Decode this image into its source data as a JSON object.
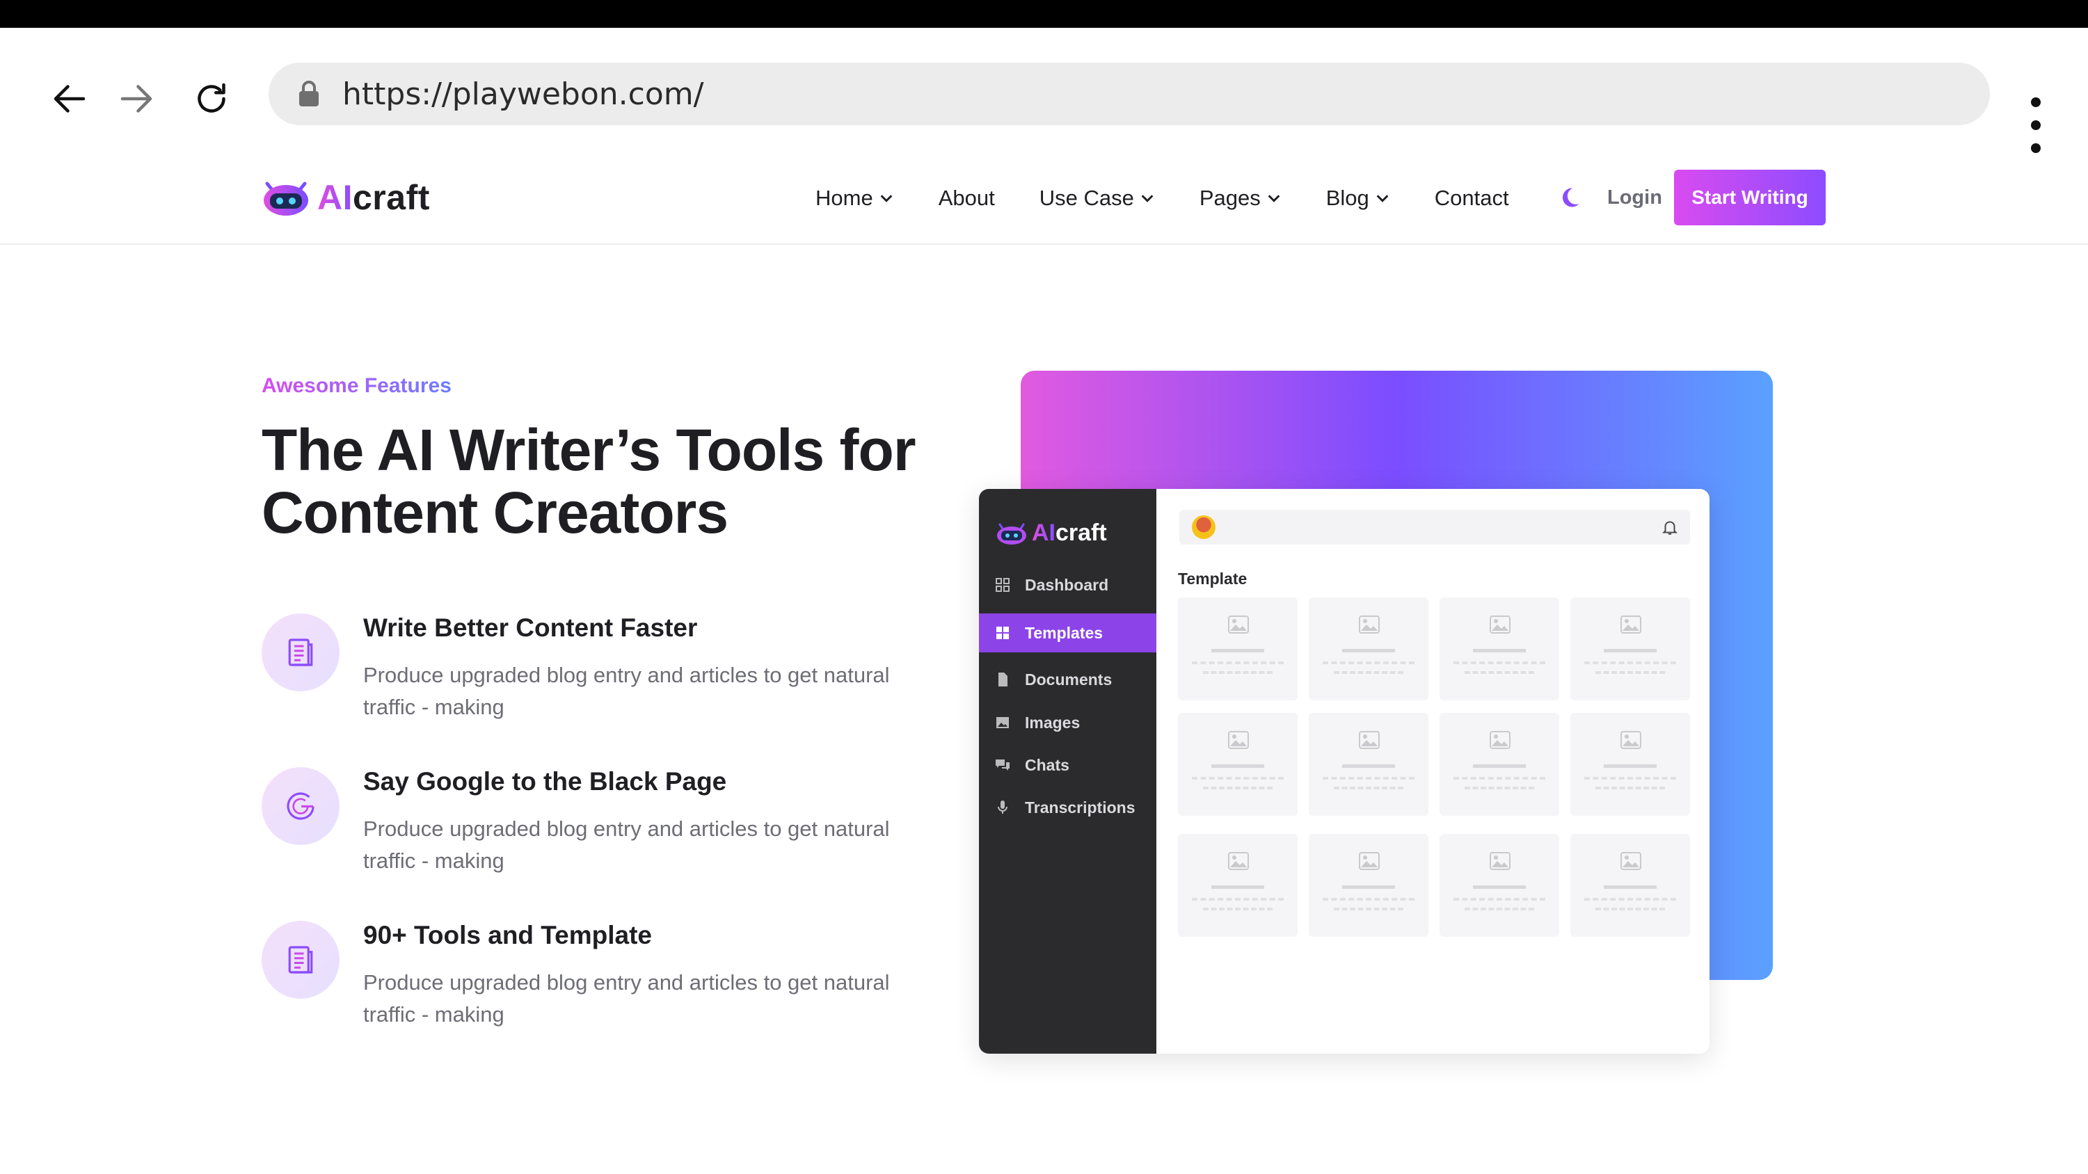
{
  "browser": {
    "url": "https://playwebon.com/",
    "back_icon": "arrow-left-icon",
    "forward_icon": "arrow-right-icon",
    "reload_icon": "reload-icon",
    "menu_icon": "kebab-menu-icon"
  },
  "header": {
    "brand_ai": "AI",
    "brand_rest": "craft",
    "menu": [
      {
        "label": "Home",
        "dropdown": true
      },
      {
        "label": "About",
        "dropdown": false
      },
      {
        "label": "Use Case",
        "dropdown": true
      },
      {
        "label": "Pages",
        "dropdown": true
      },
      {
        "label": "Blog",
        "dropdown": true
      },
      {
        "label": "Contact",
        "dropdown": false
      }
    ],
    "login": "Login",
    "cta": "Start Writing"
  },
  "hero": {
    "eyebrow": "Awesome Features",
    "headline_line1": "The AI Writer’s Tools for",
    "headline_line2": "Content Creators"
  },
  "features": [
    {
      "icon": "document-icon",
      "title": "Write Better Content Faster",
      "desc_line1": "Produce upgraded blog entry and articles to get natural",
      "desc_line2": "traffic - making"
    },
    {
      "icon": "google-icon",
      "title": "Say Google to the Black Page",
      "desc_line1": "Produce upgraded blog entry and articles to get natural",
      "desc_line2": "traffic - making"
    },
    {
      "icon": "document-icon",
      "title": "90+ Tools and Template",
      "desc_line1": "Produce upgraded blog entry and articles to get natural",
      "desc_line2": "traffic - making"
    }
  ],
  "mockup": {
    "brand_ai": "AI",
    "brand_rest": "craft",
    "nav": [
      {
        "label": "Dashboard",
        "icon": "grid-icon",
        "active": false
      },
      {
        "label": "Templates",
        "icon": "templates-icon",
        "active": true
      },
      {
        "label": "Documents",
        "icon": "file-icon",
        "active": false
      },
      {
        "label": "Images",
        "icon": "image-icon",
        "active": false
      },
      {
        "label": "Chats",
        "icon": "chat-icon",
        "active": false
      },
      {
        "label": "Transcriptions",
        "icon": "microphone-icon",
        "active": false
      }
    ],
    "section_label": "Template",
    "tile_count": 12
  },
  "colors": {
    "accent_start": "#d94bf0",
    "accent_end": "#8d4cff",
    "card_blue": "#5aa1ff",
    "sidebar_dark": "#2b2b2e"
  }
}
